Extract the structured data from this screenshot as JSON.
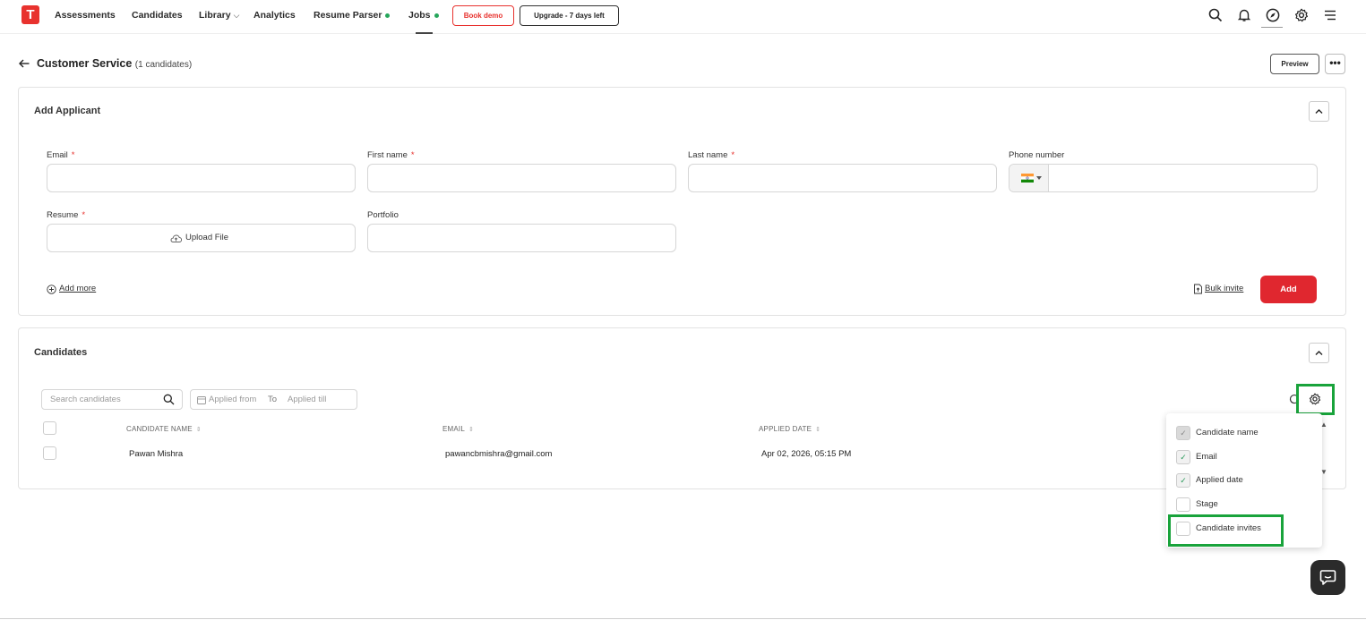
{
  "brand": {
    "logo_letter": "T",
    "accent": "#e8322e"
  },
  "nav": {
    "links": [
      "Assessments",
      "Candidates",
      "Library",
      "Analytics",
      "Resume Parser",
      "Jobs"
    ],
    "book_demo": "Book demo",
    "upgrade": "Upgrade - 7 days left",
    "icons": [
      "search-icon",
      "bell-icon",
      "compass-icon",
      "gear-icon",
      "menu-icon"
    ]
  },
  "header": {
    "title": "Customer Service",
    "count": "(1 candidates)",
    "preview": "Preview",
    "more": "•••"
  },
  "add_applicant": {
    "title": "Add Applicant",
    "fields": {
      "email": {
        "label": "Email",
        "required": "*",
        "value": ""
      },
      "first_name": {
        "label": "First name",
        "required": "*",
        "value": ""
      },
      "last_name": {
        "label": "Last name",
        "required": "*",
        "value": ""
      },
      "phone": {
        "label": "Phone number",
        "value": "",
        "country_flag": "India"
      },
      "resume": {
        "label": "Resume",
        "required": "*",
        "upload_label": "Upload File"
      },
      "portfolio": {
        "label": "Portfolio",
        "value": ""
      }
    },
    "add_more": "Add more",
    "bulk_invite": "Bulk invite",
    "add_button": "Add"
  },
  "candidates": {
    "title": "Candidates",
    "search_placeholder": "Search candidates",
    "date_from": "Applied from",
    "date_to": "To",
    "date_till": "Applied till",
    "columns": [
      "CANDIDATE NAME",
      "EMAIL",
      "APPLIED DATE"
    ],
    "rows": [
      {
        "name": "Pawan Mishra",
        "email": "pawancbmishra@gmail.com",
        "applied": "Apr 02, 2026, 05:15 PM"
      }
    ]
  },
  "column_menu": {
    "options": [
      {
        "label": "Candidate name",
        "checked": true,
        "disabled": true
      },
      {
        "label": "Email",
        "checked": true,
        "disabled": false
      },
      {
        "label": "Applied date",
        "checked": true,
        "disabled": false
      },
      {
        "label": "Stage",
        "checked": false,
        "disabled": false
      },
      {
        "label": "Candidate invites",
        "checked": false,
        "disabled": false
      }
    ],
    "check_mark": "✓"
  },
  "colors": {
    "highlight": "#19a33b",
    "add_button": "#e0272f",
    "status_dot": "#26a65b"
  }
}
